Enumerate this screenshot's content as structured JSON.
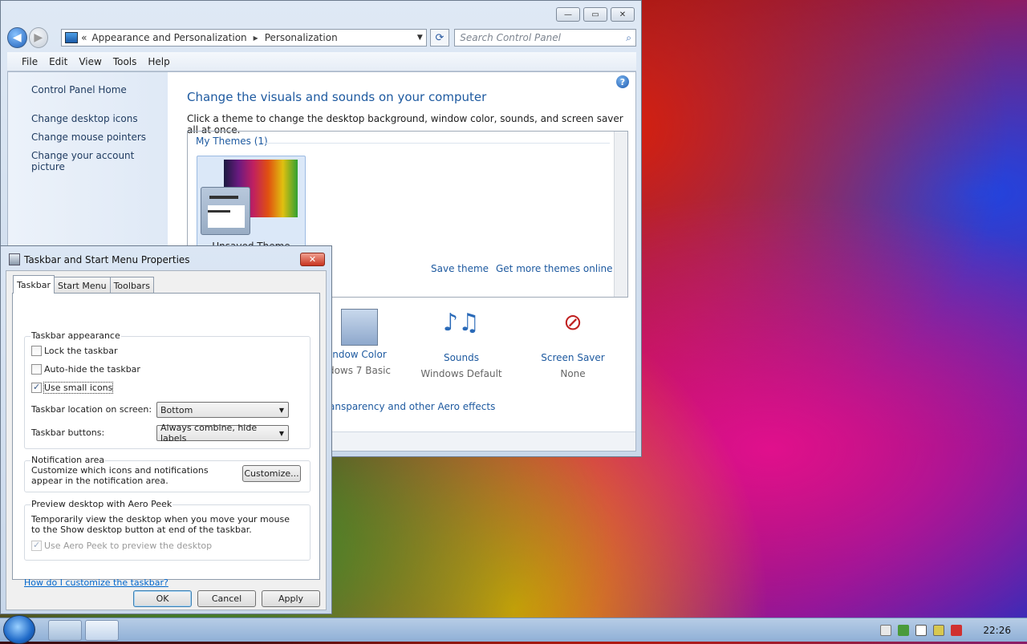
{
  "cp_window": {
    "caption_buttons": [
      "—",
      "▭",
      "✕"
    ],
    "breadcrumb": {
      "prefix": "«",
      "part1": "Appearance and Personalization",
      "arrow": "▸",
      "part2": "Personalization"
    },
    "search_placeholder": "Search Control Panel",
    "menu": [
      "File",
      "Edit",
      "View",
      "Tools",
      "Help"
    ],
    "left_links": [
      "Control Panel Home",
      "Change desktop icons",
      "Change mouse pointers",
      "Change your account picture"
    ],
    "title": "Change the visuals and sounds on your computer",
    "subtitle": "Click a theme to change the desktop background, window color, sounds, and screen saver all at once.",
    "my_themes_label": "My Themes (1)",
    "theme_name": "Unsaved Theme",
    "save_theme": "Save theme",
    "get_more_themes": "Get more themes online",
    "bottom_items": [
      {
        "title": "ndow Color",
        "value": "dows 7 Basic",
        "icon": "window-color-icon"
      },
      {
        "title": "Sounds",
        "value": "Windows Default",
        "icon": "sounds-icon"
      },
      {
        "title": "Screen Saver",
        "value": "None",
        "icon": "screen-saver-icon"
      }
    ],
    "aero_link": "ansparency and other Aero effects"
  },
  "dialog": {
    "title": "Taskbar and Start Menu Properties",
    "close": "✕",
    "tabs": [
      "Taskbar",
      "Start Menu",
      "Toolbars"
    ],
    "appearance_group": "Taskbar appearance",
    "lock_taskbar": "Lock the taskbar",
    "auto_hide": "Auto-hide the taskbar",
    "small_icons": "Use small icons",
    "location_label": "Taskbar location on screen:",
    "location_value": "Bottom",
    "buttons_label": "Taskbar buttons:",
    "buttons_value": "Always combine, hide labels",
    "notif_group": "Notification area",
    "notif_text": "Customize which icons and notifications appear in the notification area.",
    "customize_btn": "Customize...",
    "peek_group": "Preview desktop with Aero Peek",
    "peek_text": "Temporarily view the desktop when you move your mouse to the Show desktop button at end of the taskbar.",
    "peek_checkbox": "Use Aero Peek to preview the desktop",
    "help_link": "How do I customize the taskbar?",
    "ok": "OK",
    "cancel": "Cancel",
    "apply": "Apply",
    "checked": {
      "lock": false,
      "autohide": false,
      "small": true,
      "peek": true
    }
  },
  "taskbar": {
    "clock": "22:26"
  }
}
